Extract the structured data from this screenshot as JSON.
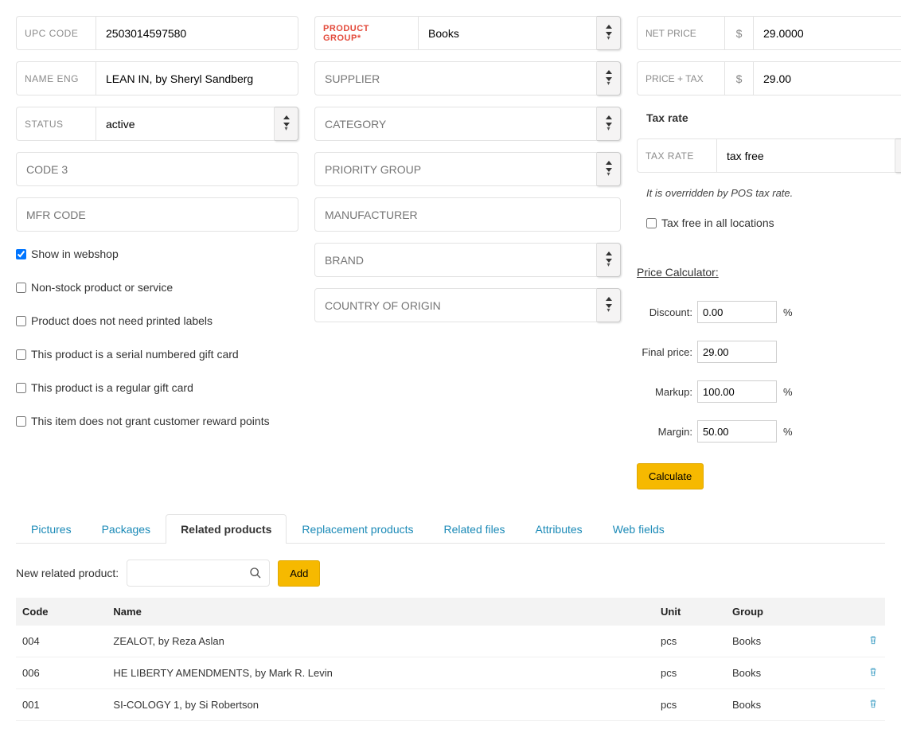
{
  "left": {
    "upc": {
      "label": "UPC CODE",
      "value": "2503014597580"
    },
    "name": {
      "label": "NAME ENG",
      "value": "LEAN IN, by Sheryl Sandberg"
    },
    "status": {
      "label": "STATUS",
      "value": "active"
    },
    "code3": {
      "label": "CODE 3",
      "value": ""
    },
    "mfr": {
      "label": "MFR CODE",
      "value": ""
    },
    "checks": {
      "webshop": "Show in webshop",
      "nonstock": "Non-stock product or service",
      "nolabels": "Product does not need printed labels",
      "serialgc": "This product is a serial numbered gift card",
      "reggc": "This product is a regular gift card",
      "norewards": "This item does not grant customer reward points"
    }
  },
  "mid": {
    "group": {
      "label": "PRODUCT GROUP*",
      "value": "Books"
    },
    "supplier": {
      "label": "SUPPLIER",
      "value": ""
    },
    "category": {
      "label": "CATEGORY",
      "value": ""
    },
    "priority": {
      "label": "PRIORITY GROUP",
      "value": ""
    },
    "manufacturer": {
      "label": "MANUFACTURER",
      "value": ""
    },
    "brand": {
      "label": "BRAND",
      "value": ""
    },
    "origin": {
      "label": "COUNTRY OF ORIGIN",
      "value": ""
    }
  },
  "right": {
    "net": {
      "label": "NET PRICE",
      "currency": "$",
      "value": "29.0000"
    },
    "tax": {
      "label": "PRICE + TAX",
      "currency": "$",
      "value": "29.00"
    },
    "taxrate_title": "Tax rate",
    "taxrate": {
      "label": "TAX RATE",
      "value": "tax free"
    },
    "override_note": "It is overridden by POS tax rate.",
    "taxfree_all": "Tax free in all locations",
    "calc_title": "Price Calculator:",
    "calc": {
      "discount": {
        "label": "Discount:",
        "value": "0.00",
        "unit": "%"
      },
      "final": {
        "label": "Final price:",
        "value": "29.00",
        "unit": ""
      },
      "markup": {
        "label": "Markup:",
        "value": "100.00",
        "unit": "%"
      },
      "margin": {
        "label": "Margin:",
        "value": "50.00",
        "unit": "%"
      }
    },
    "calc_btn": "Calculate"
  },
  "tabs": [
    "Pictures",
    "Packages",
    "Related products",
    "Replacement products",
    "Related files",
    "Attributes",
    "Web fields"
  ],
  "active_tab": 2,
  "add_label": "New related product:",
  "add_btn": "Add",
  "table": {
    "headers": [
      "Code",
      "Name",
      "Unit",
      "Group"
    ],
    "rows": [
      {
        "code": "004",
        "name": "ZEALOT, by Reza Aslan",
        "unit": "pcs",
        "group": "Books"
      },
      {
        "code": "006",
        "name": "HE LIBERTY AMENDMENTS, by Mark R. Levin",
        "unit": "pcs",
        "group": "Books"
      },
      {
        "code": "001",
        "name": "SI-COLOGY 1, by Si Robertson",
        "unit": "pcs",
        "group": "Books"
      }
    ]
  }
}
